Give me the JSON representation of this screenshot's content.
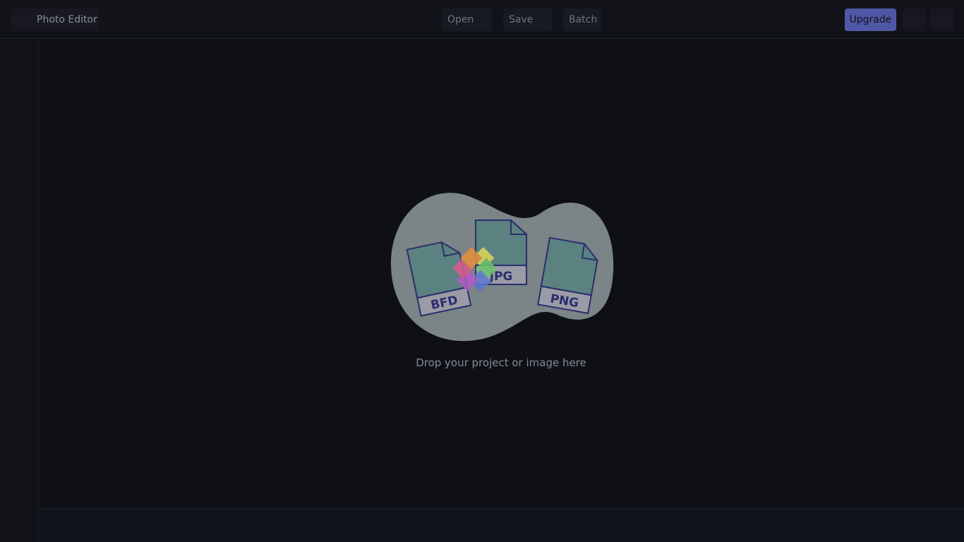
{
  "header": {
    "app_title": "Photo Editor",
    "menu": {
      "open_label": "Open",
      "save_label": "Save",
      "batch_label": "Batch"
    },
    "upgrade_label": "Upgrade"
  },
  "dropzone": {
    "message": "Drop your project or image here",
    "file_labels": {
      "left": "BFD",
      "center": "JPG",
      "right": "PNG"
    }
  },
  "colors": {
    "accent": "#5057a6",
    "background": "#0f1016",
    "illustration_blob": "#7b8486",
    "file_fill": "#5b8280",
    "file_outline": "#2a2e6c"
  }
}
